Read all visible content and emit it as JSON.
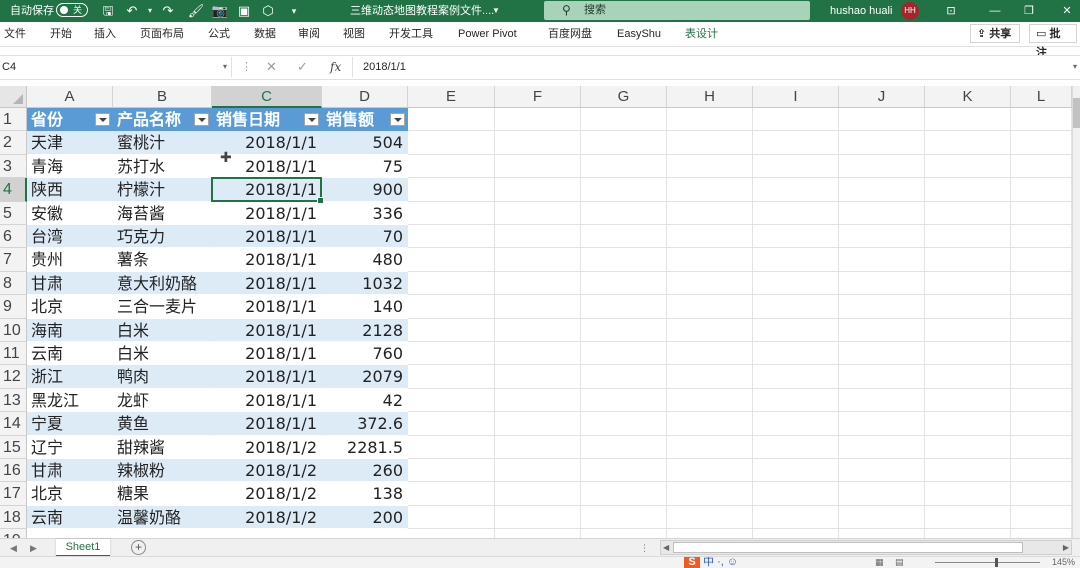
{
  "titlebar": {
    "autosave_label": "自动保存",
    "autosave_state": "关",
    "doc_title": "三维动态地图教程案例文件....",
    "search_placeholder": "搜索",
    "username": "hushao huali",
    "avatar_initials": "HH",
    "accent": "#217346"
  },
  "ribbon": {
    "tabs": [
      "文件",
      "开始",
      "插入",
      "页面布局",
      "公式",
      "数据",
      "审阅",
      "视图",
      "开发工具",
      "Power Pivot",
      "百度网盘",
      "EasyShu",
      "表设计"
    ],
    "active_tab": "表设计",
    "share_label": "共享",
    "comment_label": "批注"
  },
  "formula_bar": {
    "name_box": "C4",
    "formula_value": "2018/1/1",
    "fx_label": "fx"
  },
  "grid": {
    "columns": [
      "A",
      "B",
      "C",
      "D",
      "E",
      "F",
      "G",
      "H",
      "I",
      "J",
      "K",
      "L"
    ],
    "selected_column": "C",
    "row_numbers": [
      "1",
      "2",
      "3",
      "4",
      "5",
      "6",
      "7",
      "8",
      "9",
      "10",
      "11",
      "12",
      "13",
      "14",
      "15",
      "16",
      "17",
      "18",
      "19"
    ],
    "selected_row": "4",
    "table_header": [
      "省份",
      "产品名称",
      "销售日期",
      "销售额"
    ],
    "rows": [
      [
        "天津",
        "蜜桃汁",
        "2018/1/1",
        "504"
      ],
      [
        "青海",
        "苏打水",
        "2018/1/1",
        "75"
      ],
      [
        "陕西",
        "柠檬汁",
        "2018/1/1",
        "900"
      ],
      [
        "安徽",
        "海苔酱",
        "2018/1/1",
        "336"
      ],
      [
        "台湾",
        "巧克力",
        "2018/1/1",
        "70"
      ],
      [
        "贵州",
        "薯条",
        "2018/1/1",
        "480"
      ],
      [
        "甘肃",
        "意大利奶酪",
        "2018/1/1",
        "1032"
      ],
      [
        "北京",
        "三合一麦片",
        "2018/1/1",
        "140"
      ],
      [
        "海南",
        "白米",
        "2018/1/1",
        "2128"
      ],
      [
        "云南",
        "白米",
        "2018/1/1",
        "760"
      ],
      [
        "浙江",
        "鸭肉",
        "2018/1/1",
        "2079"
      ],
      [
        "黑龙江",
        "龙虾",
        "2018/1/1",
        "42"
      ],
      [
        "宁夏",
        "黄鱼",
        "2018/1/1",
        "372.6"
      ],
      [
        "辽宁",
        "甜辣酱",
        "2018/1/2",
        "2281.5"
      ],
      [
        "甘肃",
        "辣椒粉",
        "2018/1/2",
        "260"
      ],
      [
        "北京",
        "糖果",
        "2018/1/2",
        "138"
      ],
      [
        "云南",
        "温馨奶酪",
        "2018/1/2",
        "200"
      ]
    ],
    "table_header_color": "#5b9bd5",
    "band_color": "#ddebf7"
  },
  "sheets": {
    "tabs": [
      "Sheet1"
    ],
    "active": "Sheet1"
  },
  "statusbar": {
    "ime_text": "中 ·, ☺",
    "zoom_label": "145%"
  }
}
